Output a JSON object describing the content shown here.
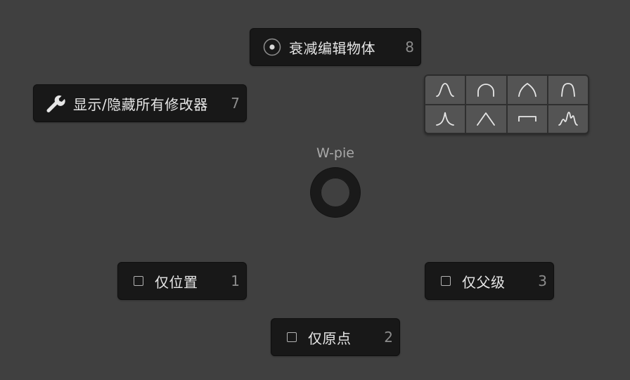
{
  "pie_menu": {
    "title": "W-pie",
    "items": {
      "falloff_edit": {
        "label": "衰减编辑物体",
        "hotkey": "8",
        "icon": "radio-dot-icon"
      },
      "toggle_modifiers": {
        "label": "显示/隐藏所有修改器",
        "hotkey": "7",
        "icon": "wrench-icon"
      },
      "location_only": {
        "label": "仅位置",
        "hotkey": "1",
        "icon": "checkbox-icon"
      },
      "parent_only": {
        "label": "仅父级",
        "hotkey": "3",
        "icon": "checkbox-icon"
      },
      "origin_only": {
        "label": "仅原点",
        "hotkey": "2",
        "icon": "checkbox-icon"
      }
    },
    "falloff_shapes": [
      "smooth-falloff-icon",
      "sphere-falloff-icon",
      "root-falloff-icon",
      "inverse-square-falloff-icon",
      "sharp-falloff-icon",
      "linear-falloff-icon",
      "constant-falloff-icon",
      "random-falloff-icon"
    ]
  },
  "colors": {
    "background": "#404040",
    "button_bg": "#181818",
    "text": "#e6e6e6",
    "hotkey": "#8c8c8c",
    "grid_cell": "#545454"
  }
}
